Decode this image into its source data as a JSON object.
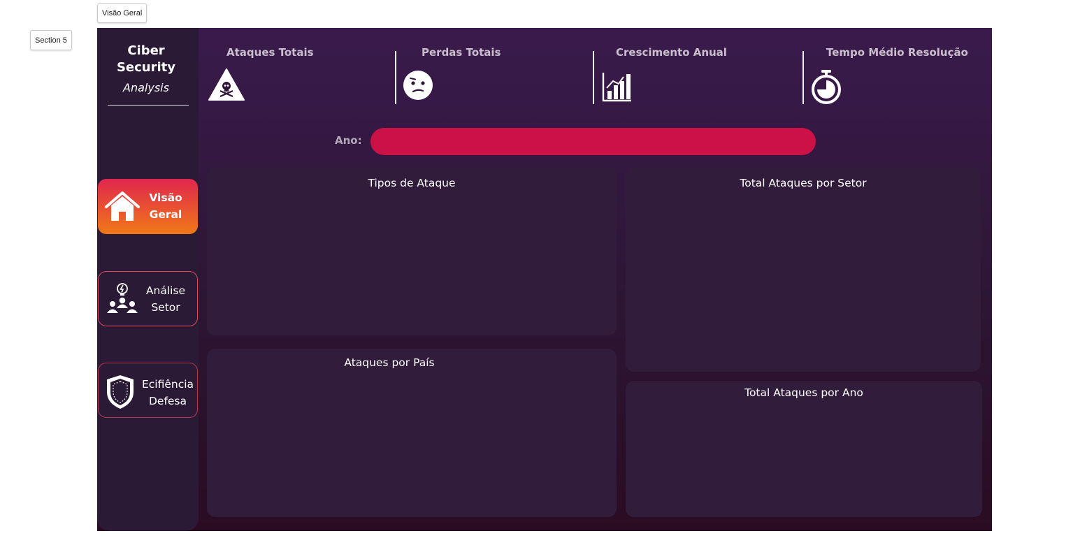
{
  "top_controls": {
    "tab_button": "Visão Geral",
    "section_button": "Section 5"
  },
  "logo": {
    "line1": "Ciber",
    "line2": "Security",
    "line3": "Analysis"
  },
  "nav": [
    {
      "line1": "Visão",
      "line2": "Geral",
      "icon": "home-icon",
      "active": true
    },
    {
      "line1": "Análise",
      "line2": "Setor",
      "icon": "team-idea-icon",
      "active": false
    },
    {
      "line1": "Ecifiência",
      "line2": "Defesa",
      "icon": "shield-icon",
      "active": false
    }
  ],
  "kpis": [
    {
      "title": "Ataques Totais",
      "icon": "warning-skull-icon"
    },
    {
      "title": "Perdas Totais",
      "icon": "confused-face-icon"
    },
    {
      "title": "Crescimento Anual",
      "icon": "bar-growth-icon"
    },
    {
      "title": "Tempo Médio Resolução",
      "icon": "stopwatch-icon"
    }
  ],
  "filter": {
    "label": "Ano:"
  },
  "cards": {
    "tipos": "Tipos de Ataque",
    "pais": "Ataques por País",
    "setor": "Total Ataques por Setor",
    "ano": "Total Ataques por Ano"
  },
  "colors": {
    "accent": "#cc1147",
    "gradient_start": "#e0264e",
    "gradient_end": "#f07818",
    "background_top": "#3a1a4c",
    "background_bottom": "#2a0b22"
  }
}
